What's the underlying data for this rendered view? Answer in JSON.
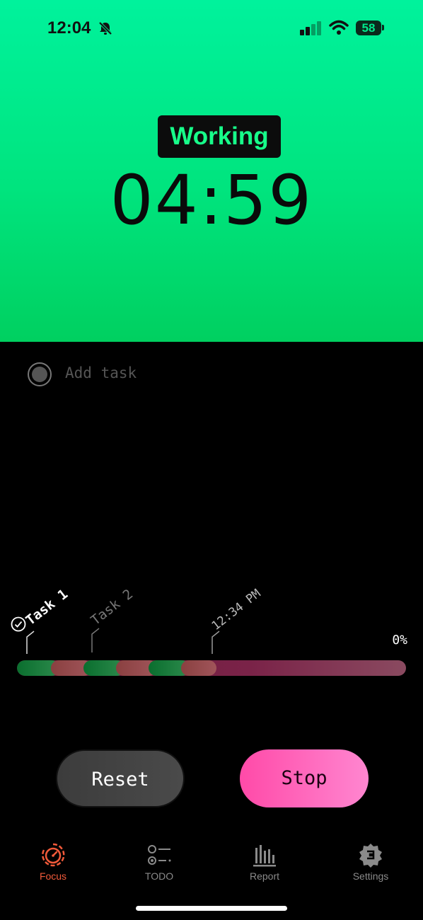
{
  "status_bar": {
    "time": "12:04",
    "battery": "58"
  },
  "timer": {
    "mode": "Working",
    "time": "04:59"
  },
  "add_task": {
    "label": "Add task"
  },
  "timeline": {
    "task1": "Task 1",
    "task2": "Task 2",
    "time_marker": "12:34 PM",
    "percent": "0%"
  },
  "buttons": {
    "reset": "Reset",
    "stop": "Stop"
  },
  "tabs": [
    {
      "label": "Focus",
      "icon": "timer-icon",
      "active": true
    },
    {
      "label": "TODO",
      "icon": "checklist-icon",
      "active": false
    },
    {
      "label": "Report",
      "icon": "bar-chart-icon",
      "active": false
    },
    {
      "label": "Settings",
      "icon": "gear-icon",
      "active": false
    }
  ],
  "colors": {
    "working_bg": "#00e47e",
    "badge_text": "#17ff8a",
    "accent_stop": "#ff4aa8",
    "active_tab": "#f25a3a"
  }
}
